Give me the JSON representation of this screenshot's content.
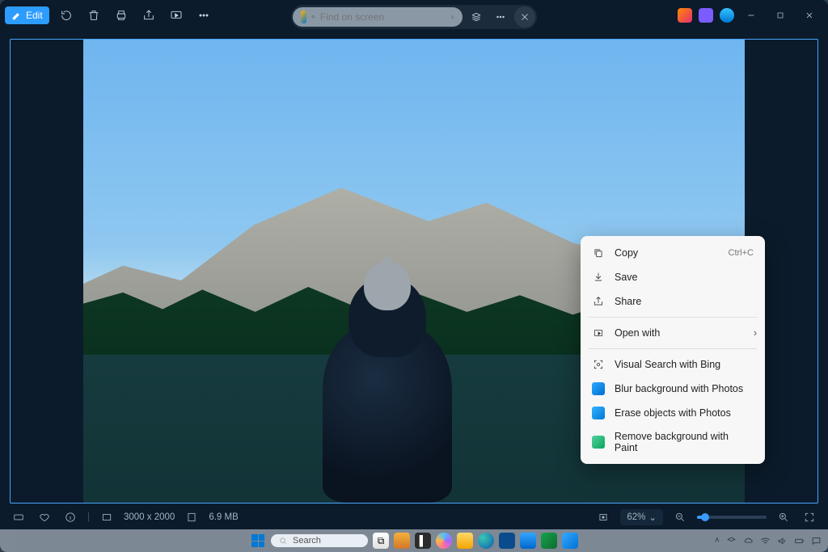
{
  "toolbar": {
    "edit_label": "Edit"
  },
  "search": {
    "placeholder": "Find on screen"
  },
  "context_menu": {
    "copy": "Copy",
    "copy_shortcut": "Ctrl+C",
    "save": "Save",
    "share": "Share",
    "open_with": "Open with",
    "visual_search": "Visual Search with Bing",
    "blur_bg": "Blur background with Photos",
    "erase_obj": "Erase objects with Photos",
    "remove_bg": "Remove background with Paint"
  },
  "status": {
    "dimensions": "3000 x 2000",
    "filesize": "6.9 MB",
    "zoom": "62%"
  },
  "taskbar": {
    "search_placeholder": "Search"
  }
}
